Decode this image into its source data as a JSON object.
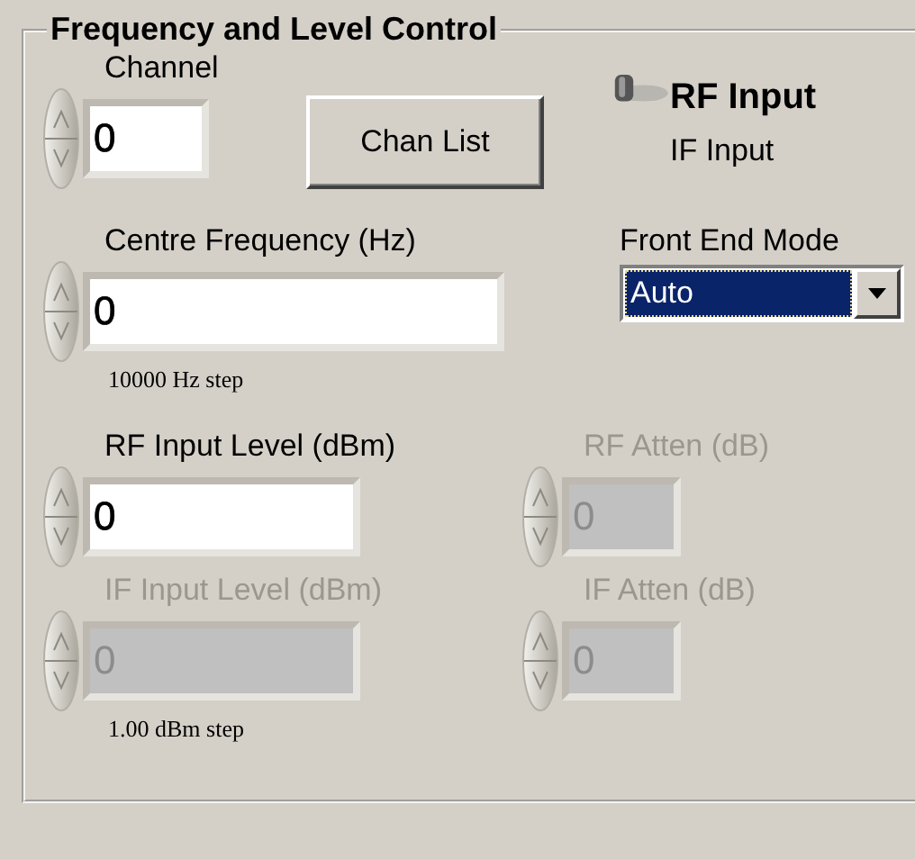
{
  "group": {
    "title": "Frequency and Level Control"
  },
  "channel": {
    "label": "Channel",
    "value": "0",
    "disabled": false
  },
  "chan_list_button": {
    "label": "Chan List"
  },
  "input_switch": {
    "options": [
      {
        "label": "RF Input",
        "selected": true
      },
      {
        "label": "IF Input",
        "selected": false
      }
    ]
  },
  "centre_frequency": {
    "label": "Centre Frequency (Hz)",
    "value": "0",
    "disabled": false,
    "step": "10000 Hz step"
  },
  "front_end_mode": {
    "label": "Front End Mode",
    "value": "Auto",
    "focused": true
  },
  "rf_input_level": {
    "label": "RF Input Level (dBm)",
    "value": "0",
    "disabled": false
  },
  "rf_atten": {
    "label": "RF Atten (dB)",
    "value": "0",
    "disabled": true
  },
  "if_input_level": {
    "label": "IF Input Level (dBm)",
    "value": "0",
    "disabled": true,
    "step": "1.00 dBm step"
  },
  "if_atten": {
    "label": "IF Atten (dB)",
    "value": "0",
    "disabled": true
  }
}
